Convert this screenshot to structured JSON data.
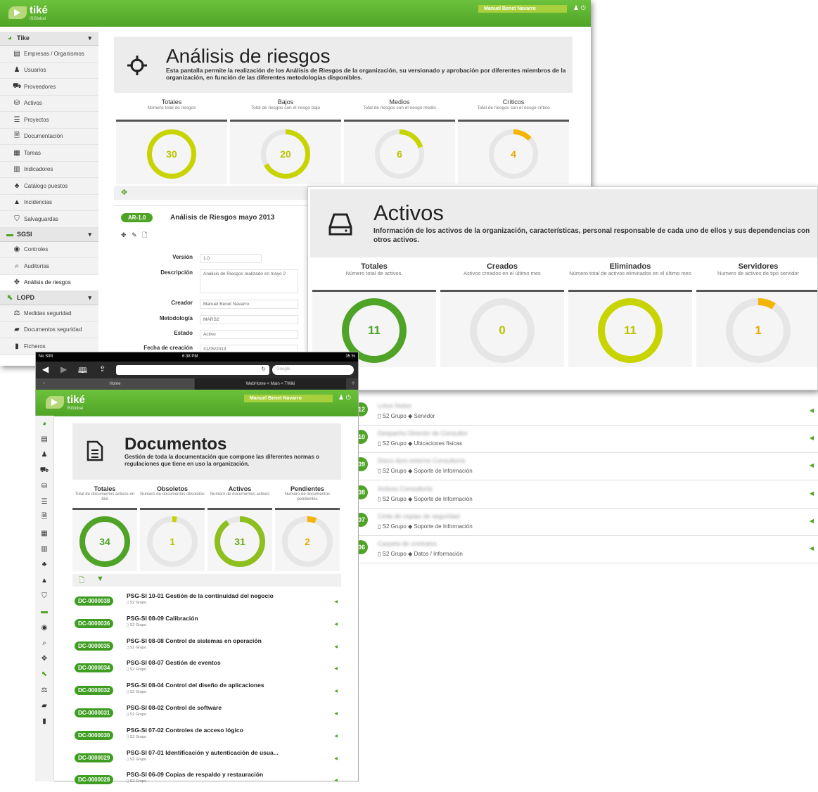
{
  "app": {
    "logo_text": "tiké",
    "logo_sub": "ISGlobal",
    "user_name": "Manuel Benet Navarro",
    "icons": [
      "user-icon",
      "power-icon"
    ]
  },
  "sidebar": {
    "sections": [
      {
        "label": "Tike",
        "items": [
          {
            "icon": "▤",
            "label": "Empresas / Organismos"
          },
          {
            "icon": "♟",
            "label": "Usuarios"
          },
          {
            "icon": "⛟",
            "label": "Proveedores"
          },
          {
            "icon": "⛁",
            "label": "Activos"
          },
          {
            "icon": "☰",
            "label": "Proyectos"
          },
          {
            "icon": "🗎",
            "label": "Documentación"
          },
          {
            "icon": "▦",
            "label": "Tareas"
          },
          {
            "icon": "▥",
            "label": "Indicadores"
          },
          {
            "icon": "♣",
            "label": "Catálogo puestos"
          },
          {
            "icon": "▲",
            "label": "Incidencias"
          },
          {
            "icon": "⛉",
            "label": "Salvaguardas"
          }
        ]
      },
      {
        "label": "SGSI",
        "items": [
          {
            "icon": "◉",
            "label": "Controles"
          },
          {
            "icon": "⌕",
            "label": "Auditorías"
          },
          {
            "icon": "✥",
            "label": "Análisis de riesgos",
            "active": true
          }
        ]
      },
      {
        "label": "LOPD",
        "items": [
          {
            "icon": "⚖",
            "label": "Medidas seguridad"
          },
          {
            "icon": "▰",
            "label": "Documentos seguridad"
          },
          {
            "icon": "▮",
            "label": "Ficheros"
          }
        ]
      }
    ]
  },
  "riesgos": {
    "title": "Análisis de riesgos",
    "desc": "Esta pantalla permite la realización de los Análisis de Riesgos de la organización, su versionado y aprobación por diferentes miembros de la organización, en función de las diferentes metodologías disponibles.",
    "stats": [
      {
        "title": "Totales",
        "sub": "Número total de riesgos",
        "value": "30",
        "fraction": 1.0,
        "color": "#c8d400"
      },
      {
        "title": "Bajos",
        "sub": "Total de riesgos con el riesgo bajo",
        "value": "20",
        "fraction": 0.67,
        "color": "#c8d400"
      },
      {
        "title": "Medios",
        "sub": "Total de riesgos con el riesgo medio",
        "value": "6",
        "fraction": 0.2,
        "color": "#c8d400"
      },
      {
        "title": "Críticos",
        "sub": "Total de riesgos con el riesgo crítico",
        "value": "4",
        "fraction": 0.13,
        "color": "#f5b400"
      }
    ],
    "version_badge": "AR-1.0",
    "version_title": "Análisis de Riesgos mayo 2013",
    "form": [
      {
        "label": "Versión",
        "value": "1.0"
      },
      {
        "label": "Descripción",
        "value": "Análisis de Riesgos realizado en mayo 2"
      },
      {
        "label": "Creador",
        "value": "Manuel Benet Navarro"
      },
      {
        "label": "Metodología",
        "value": "MARS2"
      },
      {
        "label": "Estado",
        "value": "Activo"
      },
      {
        "label": "Fecha de creación",
        "value": "31/05/2013"
      }
    ]
  },
  "activos": {
    "title": "Activos",
    "desc": "Información de los activos de la organización, características, personal responsable de cada uno de ellos y sus dependencias con otros activos.",
    "stats": [
      {
        "title": "Totales",
        "sub": "Número total de activos.",
        "value": "11",
        "fraction": 1.0,
        "color": "#4fa326"
      },
      {
        "title": "Creados",
        "sub": "Activos creados en el último mes",
        "value": "0",
        "fraction": 0,
        "color": "#4fa326"
      },
      {
        "title": "Eliminados",
        "sub": "Número total de activos eliminados en el último mes",
        "value": "11",
        "fraction": 1.0,
        "color": "#c8d400"
      },
      {
        "title": "Servidores",
        "sub": "Numero de activos de tipo servidor",
        "value": "1",
        "fraction": 0.09,
        "color": "#f5b400"
      }
    ],
    "list": [
      {
        "num": "12",
        "name": "Lotus Notes",
        "group": "S2 Grupo",
        "type": "Servidor"
      },
      {
        "num": "10",
        "name": "Despacho Director de Consultor",
        "group": "S2 Grupo",
        "type": "Ubicaciones físicas"
      },
      {
        "num": "09",
        "name": "Disco duro externo Consultoría",
        "group": "S2 Grupo",
        "type": "Soporte de Información"
      },
      {
        "num": "08",
        "name": "Activos Consultoría",
        "group": "S2 Grupo",
        "type": "Soporte de Información"
      },
      {
        "num": "07",
        "name": "Cinta de copias de seguridad",
        "group": "S2 Grupo",
        "type": "Soporte de Información"
      },
      {
        "num": "06",
        "name": "Carpeta de contratos",
        "group": "S2 Grupo",
        "type": "Datos / Información"
      }
    ]
  },
  "ipad": {
    "status_carrier": "No SIM",
    "status_time": "6:38 PM",
    "status_battery": "35 %",
    "search_placeholder": "Google",
    "tabs": [
      "Home",
      "WebHome < Main < TWiki"
    ]
  },
  "documentos": {
    "title": "Documentos",
    "desc": "Gestión de toda la documentación que compone las diferentes normas o regulaciones que tiene en uso la organización.",
    "stats": [
      {
        "title": "Totales",
        "sub": "Total de documentos activos en tiké",
        "value": "34",
        "fraction": 1.0,
        "color": "#4fa326"
      },
      {
        "title": "Obsoletos",
        "sub": "Numero de documentos obsoletos",
        "value": "1",
        "fraction": 0.03,
        "color": "#c8d400"
      },
      {
        "title": "Activos",
        "sub": "Numero de documentos activos",
        "value": "31",
        "fraction": 0.91,
        "color": "#8dbf1f"
      },
      {
        "title": "Pendientes",
        "sub": "Numero de documentos pendientes",
        "value": "2",
        "fraction": 0.06,
        "color": "#f5b400"
      }
    ],
    "list": [
      {
        "code": "DC-0000038",
        "title": "PSG-SI 10-01 Gestión de la continuidad del negocio",
        "group": "S2 Grupo"
      },
      {
        "code": "DC-0000036",
        "title": "PSG-SI 08-09 Calibración",
        "group": "S2 Grupo"
      },
      {
        "code": "DC-0000035",
        "title": "PSG-SI 08-08 Control de sistemas en operación",
        "group": "S2 Grupo"
      },
      {
        "code": "DC-0000034",
        "title": "PSG-SI 08-07 Gestión de eventos",
        "group": "S2 Grupo"
      },
      {
        "code": "DC-0000032",
        "title": "PSG-SI 08-04 Control del diseño de aplicaciones",
        "group": "S2 Grupo"
      },
      {
        "code": "DC-0000031",
        "title": "PSG-SI 08-02 Control de software",
        "group": "S2 Grupo"
      },
      {
        "code": "DC-0000030",
        "title": "PSG-SI 07-02 Controles de acceso lógico",
        "group": "S2 Grupo"
      },
      {
        "code": "DC-0000029",
        "title": "PSG-SI 07-01 Identificación y autenticación de usua...",
        "group": "S2 Grupo"
      },
      {
        "code": "DC-0000028",
        "title": "PSG-SI 06-09 Copias de respaldo y restauración",
        "group": "S2 Grupo"
      }
    ]
  }
}
